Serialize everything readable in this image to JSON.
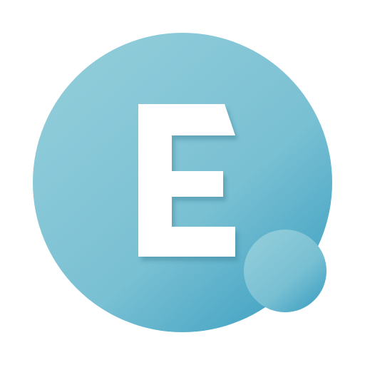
{
  "logo": {
    "letter": "E",
    "colors": {
      "bubble_light": "#8ecbd9",
      "bubble_mid": "#6fb9cf",
      "bubble_dark": "#3fa1c2",
      "letter": "#ffffff",
      "background": "#ffffff"
    }
  }
}
